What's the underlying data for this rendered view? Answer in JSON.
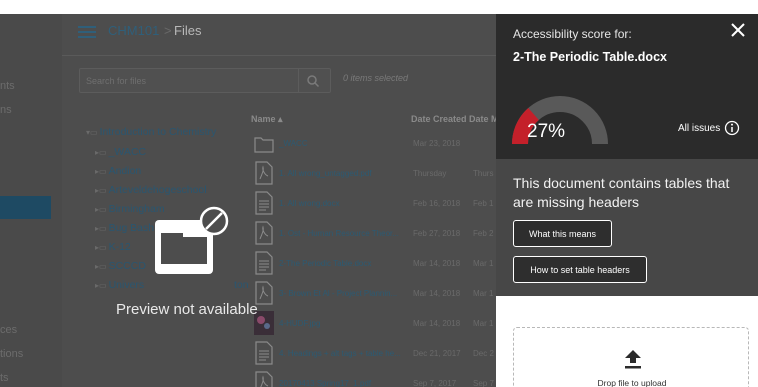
{
  "header": {
    "course": "CHM101",
    "separator": ">",
    "section": "Files"
  },
  "left_nav": {
    "items": [
      "nts",
      "ns",
      "ces",
      "tions",
      "ts"
    ]
  },
  "toolbar": {
    "search_placeholder": "Search for files",
    "selected_count": "0 items selected"
  },
  "tree": [
    {
      "label": "Introduction to Chemistry",
      "expanded": true
    },
    {
      "label": "_WACC"
    },
    {
      "label": "Andion"
    },
    {
      "label": "Arteveldehogeschool"
    },
    {
      "label": "Birmingham"
    },
    {
      "label": "Bug Bash"
    },
    {
      "label": "K-12"
    },
    {
      "label": "SCCCD"
    },
    {
      "label": "Univers"
    },
    {
      "label": "ton"
    }
  ],
  "table": {
    "columns": [
      "Name ▴",
      "Date Created",
      "Date M"
    ],
    "rows": [
      {
        "icon": "folder-icon",
        "name": "_WACC",
        "created": "Mar 23, 2018",
        "modified": ""
      },
      {
        "icon": "pdf-file-icon",
        "name": "1. All wrong_untagged.pdf",
        "created": "Thursday",
        "modified": "Thurs"
      },
      {
        "icon": "document-file-icon",
        "name": "1. All wrong.docx",
        "created": "Feb 16, 2018",
        "modified": "Feb 1"
      },
      {
        "icon": "pdf-file-icon",
        "name": "1. Ost - Human Resource Theor...",
        "created": "Feb 27, 2018",
        "modified": "Feb 2"
      },
      {
        "icon": "document-file-icon",
        "name": "2-The Periodic Table.docx",
        "created": "Mar 14, 2018",
        "modified": "Mar 1"
      },
      {
        "icon": "pdf-file-icon",
        "name": "3- Brown Et Al - Project Plannin...",
        "created": "Mar 14, 2018",
        "modified": "Mar 1"
      },
      {
        "icon": "image-file-icon",
        "name": "4-HUDF.jpg",
        "created": "Mar 14, 2018",
        "modified": "Mar 1"
      },
      {
        "icon": "document-file-icon",
        "name": "4. Headings + alt tags + table he...",
        "created": "Dec 21, 2017",
        "modified": "Dec 2"
      },
      {
        "icon": "pdf-file-icon",
        "name": "20170413 Spring17_1.pdf",
        "created": "Sep 7, 2017",
        "modified": "Sep 7"
      }
    ]
  },
  "preview": {
    "message": "Preview not available"
  },
  "tray": {
    "score_label": "Accessibility score for:",
    "document_name": "2-The Periodic Table.docx",
    "score": 27,
    "score_text": "27%",
    "all_issues": "All issues",
    "issue_message": "This document contains tables that are missing headers",
    "what_button": "What this means",
    "how_button": "How to set table headers",
    "drop_text": "Drop file to upload",
    "colors": {
      "score_fill": "#c4202a",
      "gauge_track": "#595959"
    }
  }
}
